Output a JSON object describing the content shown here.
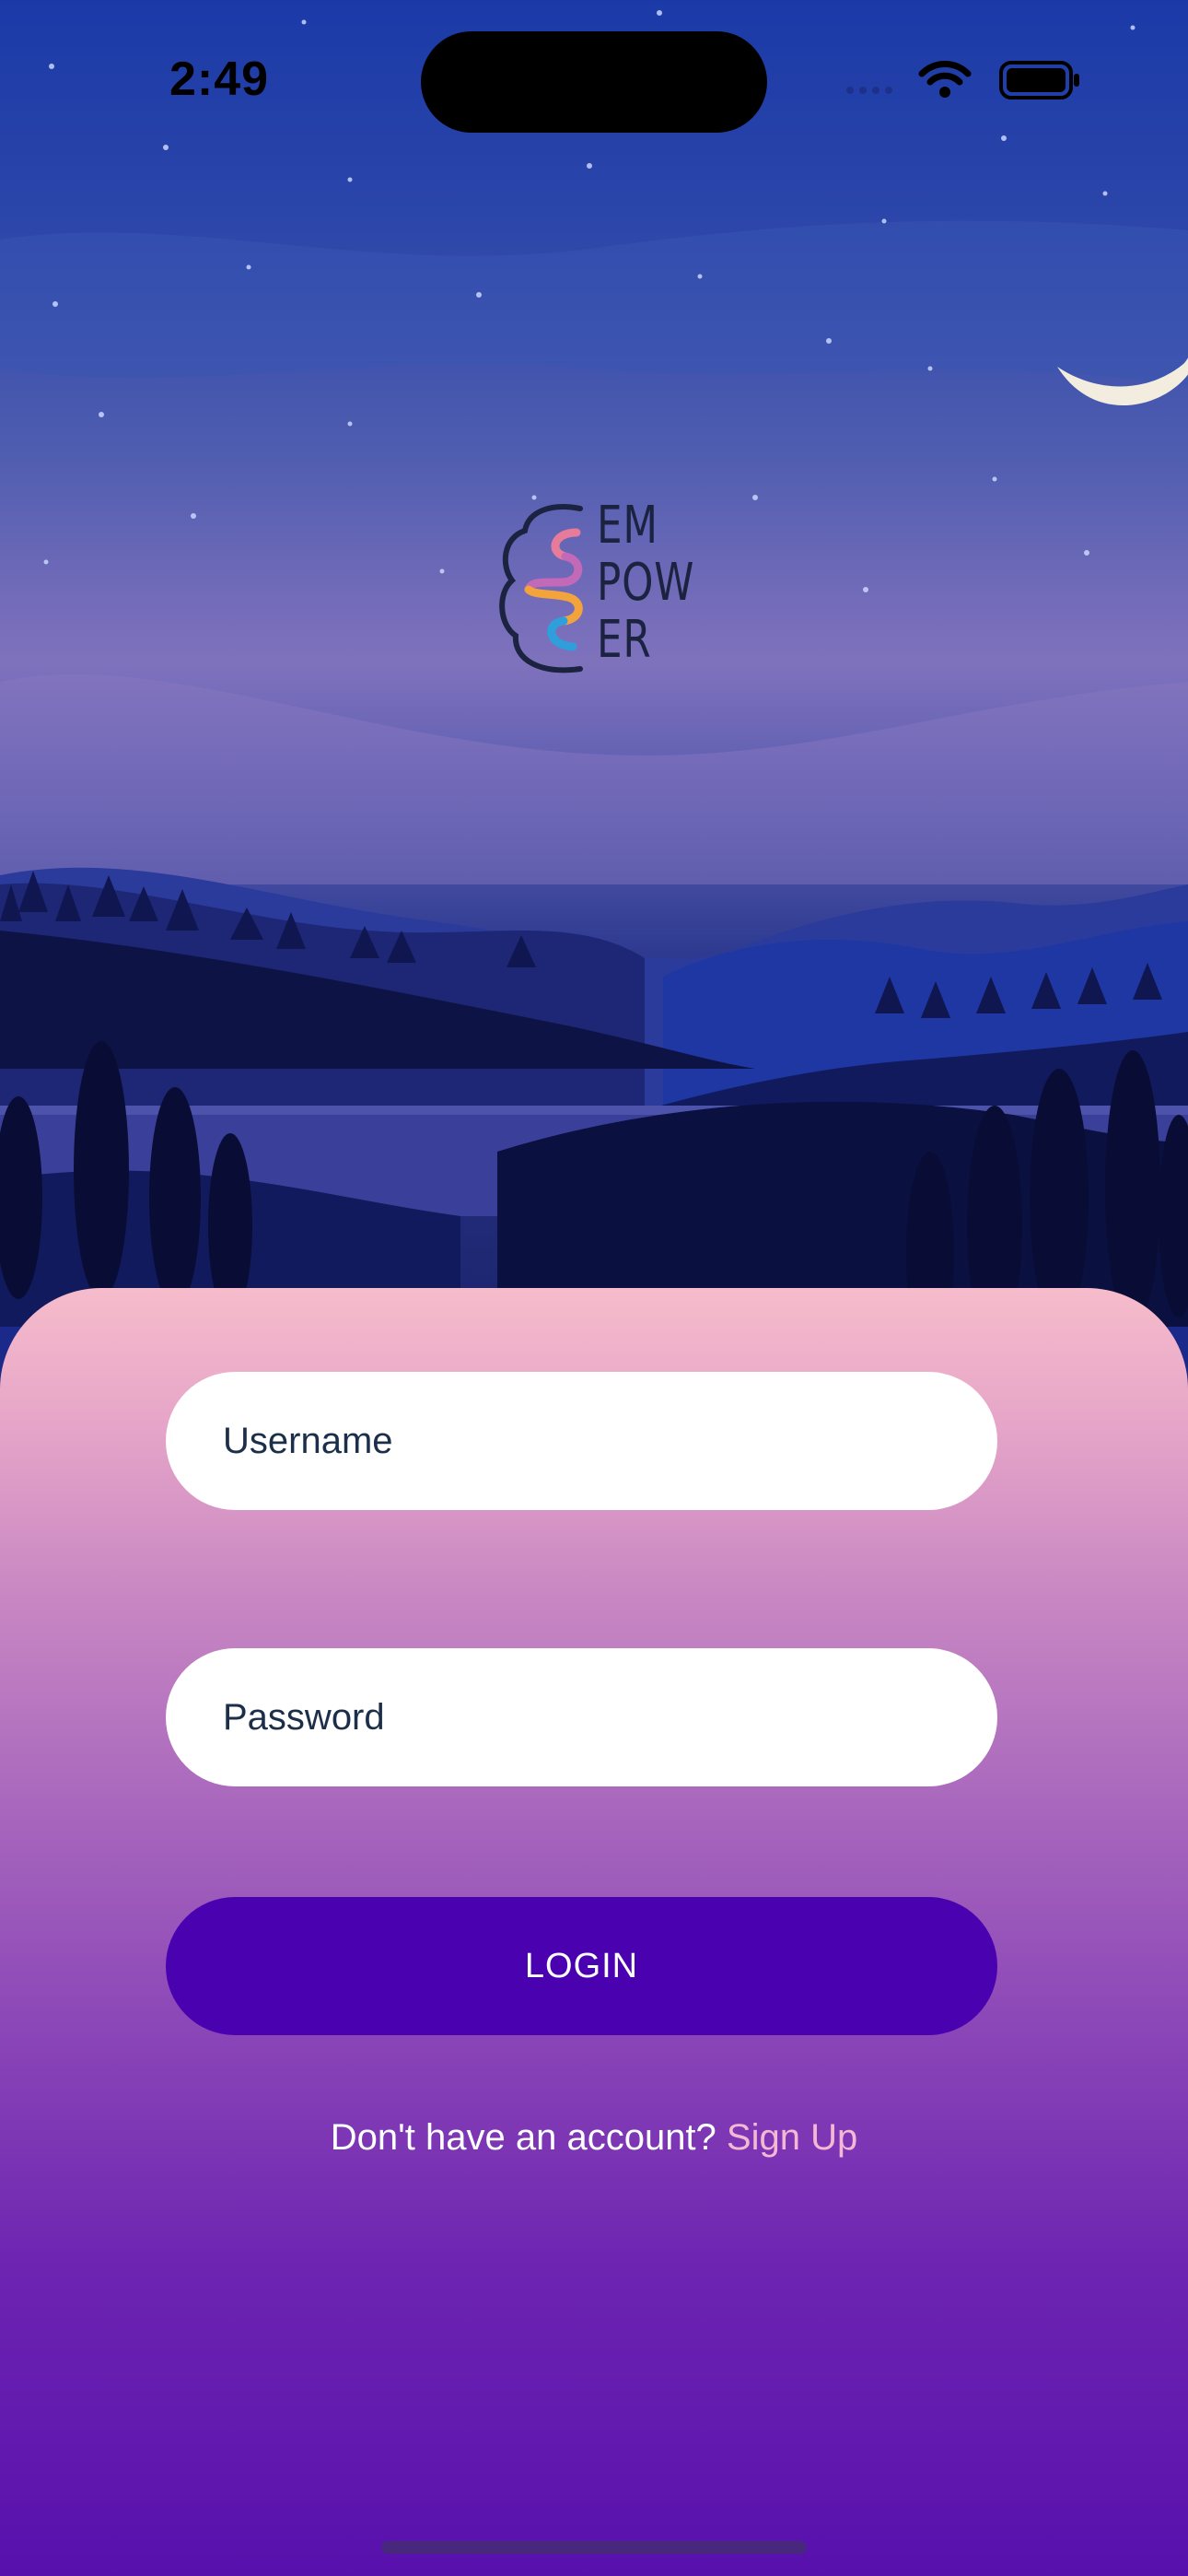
{
  "status_bar": {
    "time": "2:49"
  },
  "logo": {
    "lines": [
      "EM",
      "POW",
      "ER"
    ],
    "icon": "brain-logo-icon"
  },
  "form": {
    "username_placeholder": "Username",
    "password_placeholder": "Password",
    "login_label": "LOGIN"
  },
  "signup": {
    "prompt": "Don't have an account?",
    "link_label": "Sign Up"
  },
  "colors": {
    "login_button": "#4a02b1",
    "signup_link": "#f5b8d4",
    "card_top": "#f6bccb",
    "card_bottom": "#5810ad"
  }
}
